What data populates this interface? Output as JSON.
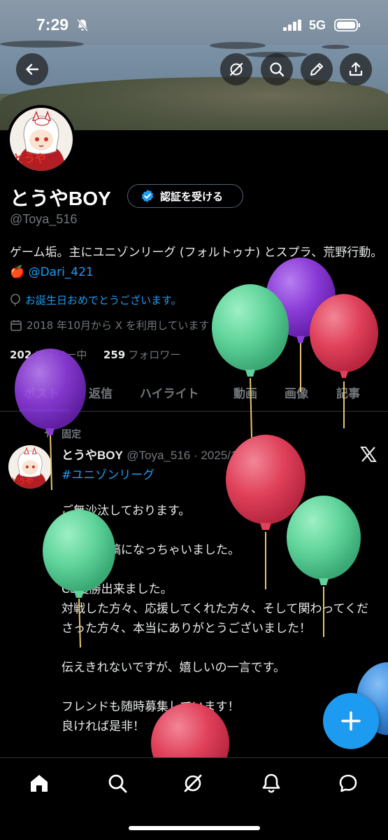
{
  "status_bar": {
    "time": "7:29",
    "network": "5G"
  },
  "profile": {
    "name": "とうやBOY",
    "verify_label": "認証を受ける",
    "handle": "@Toya_516",
    "bio_text": "ゲーム垢。主にユニゾンリーグ (フォルトゥナ) とスプラ、荒野行動。",
    "bio_emoji": "🍎",
    "bio_mention": "@Dari_421",
    "birthday": "お誕生日おめでとうございます。",
    "joined": "2018 年10月から X を利用しています",
    "following_count": "202",
    "following_label": "フォロー中",
    "followers_count": "259",
    "followers_label": "フォロワー"
  },
  "tabs": [
    "ポスト",
    "返信",
    "ハイライト",
    "動画",
    "画像",
    "記事"
  ],
  "post": {
    "pinned_label": "固定",
    "author": "とうやBOY",
    "meta": "@Toya_516 · 2025/12/03",
    "hashtag": "#ユニゾンリーグ",
    "p1": "ご無沙汰しております。",
    "p2": "後日の投稿になっちゃいました。",
    "p3a": "CS優勝出来ました。",
    "p3b": "対戦した方々、応援してくれた方々、そして関わってくださった方々、本当にありがとうございました！",
    "p4": "伝えきれないですが、嬉しいの一言です。",
    "p5a": "フレンドも随時募集しています！",
    "p5b": "良ければ是非！"
  },
  "icons": {
    "back": "arrow-left-icon",
    "grok": "grok-icon",
    "search": "search-icon",
    "edit": "pencil-icon",
    "share": "share-icon",
    "fab": "plus-icon"
  },
  "colors": {
    "accent": "#1d9bf0",
    "balloon_green": "#5fd39a",
    "balloon_purple": "#8a3ad6",
    "balloon_red": "#e0405a",
    "balloon_blue": "#3d8fe0"
  }
}
